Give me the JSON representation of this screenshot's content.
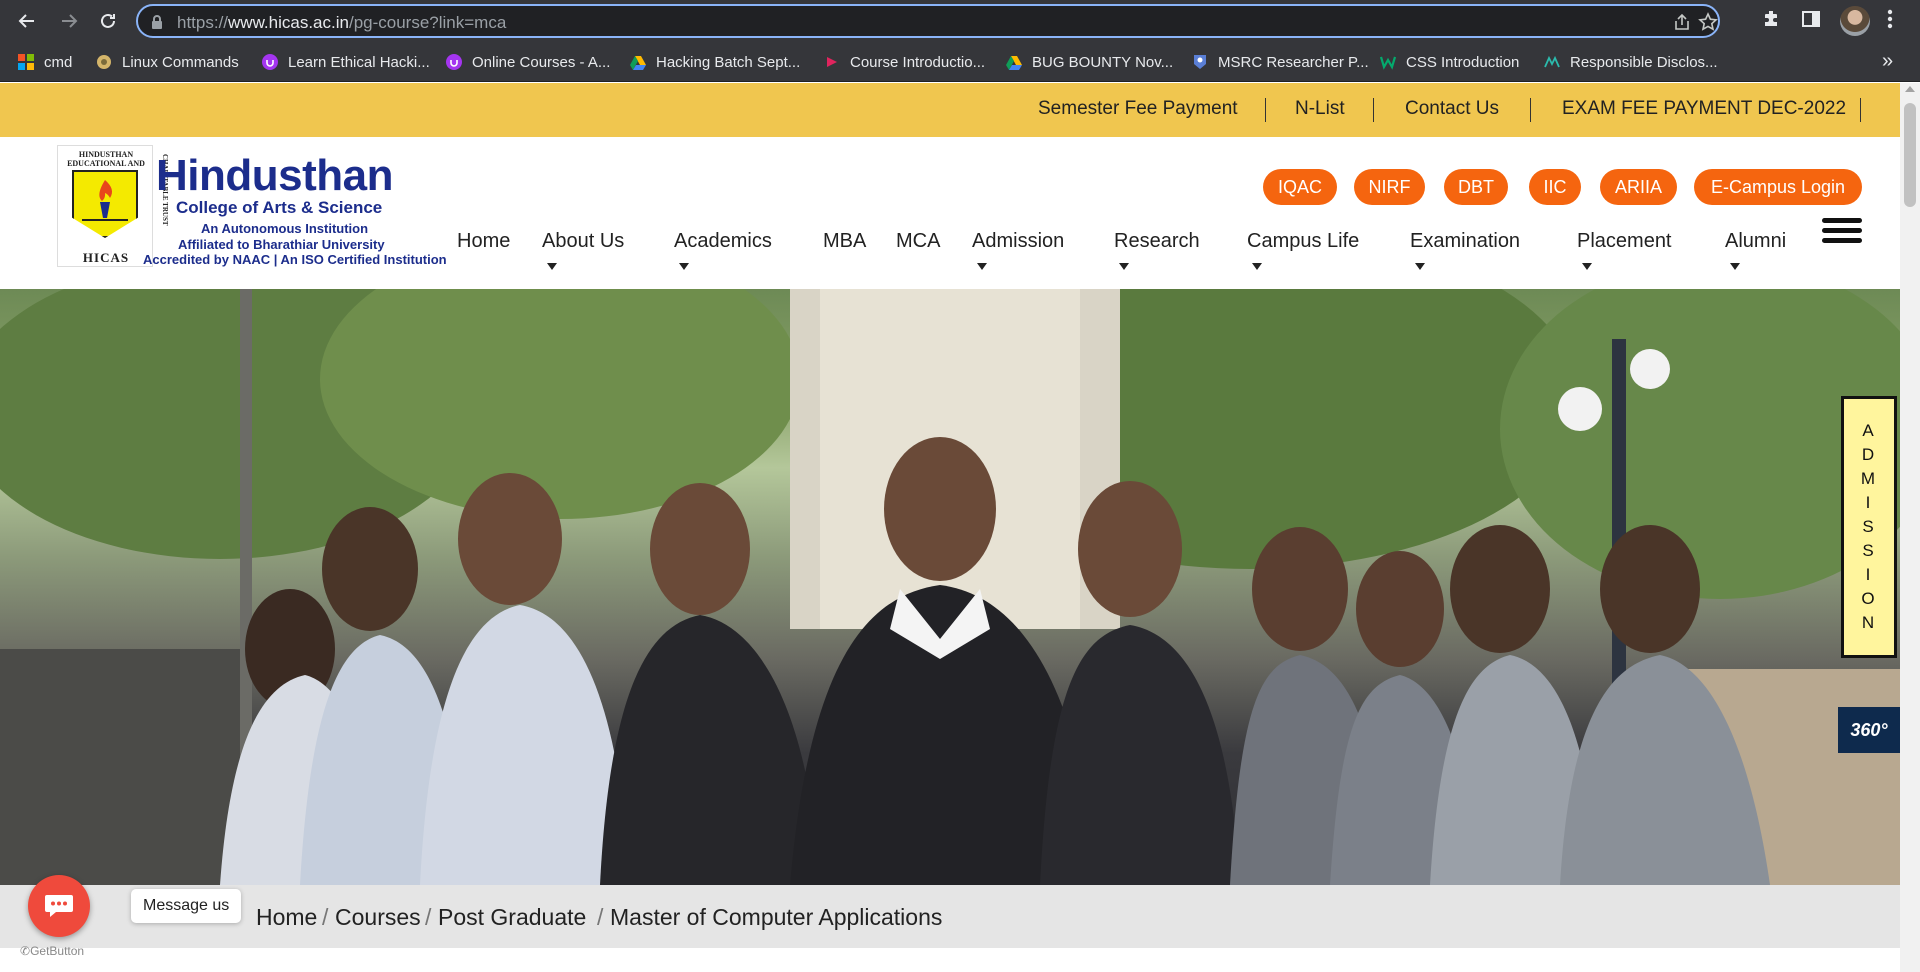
{
  "browser": {
    "url_prefix": "https://",
    "url_host": "www.hicas.ac.in",
    "url_path": "/pg-course?link=mca",
    "bookmarks": [
      {
        "label": "cmd",
        "icon": "windows-icon"
      },
      {
        "label": "Linux Commands",
        "icon": "linux-icon"
      },
      {
        "label": "Learn Ethical Hacki...",
        "icon": "udemy-icon"
      },
      {
        "label": "Online Courses - A...",
        "icon": "udemy-icon"
      },
      {
        "label": "Hacking Batch Sept...",
        "icon": "drive-icon"
      },
      {
        "label": "Course Introductio...",
        "icon": "course-icon"
      },
      {
        "label": "BUG BOUNTY Nov...",
        "icon": "drive-icon"
      },
      {
        "label": "MSRC Researcher P...",
        "icon": "msrc-icon"
      },
      {
        "label": "CSS Introduction",
        "icon": "w3schools-icon"
      },
      {
        "label": "Responsible Disclos...",
        "icon": "disclosure-icon"
      }
    ],
    "bookmarks_more": "»"
  },
  "topbar": {
    "links": [
      "Semester Fee Payment",
      "N-List",
      "Contact Us",
      "EXAM FEE PAYMENT DEC-2022"
    ]
  },
  "logo": {
    "top_text": "HINDUSTHAN EDUCATIONAL AND",
    "side_text": "CHARITABLE TRUST",
    "bottom_text": "HICAS"
  },
  "brand": {
    "name": "Hindusthan",
    "subtitle": "College of Arts & Science",
    "line1": "An Autonomous Institution",
    "line2": "Affiliated to Bharathiar University",
    "line3": "Accredited by NAAC | An ISO Certified Institution"
  },
  "quick_links": [
    "IQAC",
    "NIRF",
    "DBT",
    "IIC",
    "ARIIA",
    "E-Campus Login"
  ],
  "nav": [
    {
      "label": "Home",
      "dropdown": false
    },
    {
      "label": "About Us",
      "dropdown": true
    },
    {
      "label": "Academics",
      "dropdown": true
    },
    {
      "label": "MBA",
      "dropdown": false
    },
    {
      "label": "MCA",
      "dropdown": false
    },
    {
      "label": "Admission",
      "dropdown": true
    },
    {
      "label": "Research",
      "dropdown": true
    },
    {
      "label": "Campus Life",
      "dropdown": true
    },
    {
      "label": "Examination",
      "dropdown": true
    },
    {
      "label": "Placement",
      "dropdown": true
    },
    {
      "label": "Alumni",
      "dropdown": true
    }
  ],
  "admission_tab": "ADMISSION",
  "tour_badge": "360°",
  "breadcrumb": [
    "Home",
    "Courses",
    "Post Graduate",
    "Master of Computer Applications"
  ],
  "breadcrumb_separator": "/",
  "chat": {
    "label": "Message us",
    "powered_by": "GetButton"
  },
  "colors": {
    "topbar": "#f0c64f",
    "pill": "#f5650f",
    "brand": "#1c2d8c",
    "admission_tab": "#fff59d",
    "chat": "#ef4a3c"
  }
}
